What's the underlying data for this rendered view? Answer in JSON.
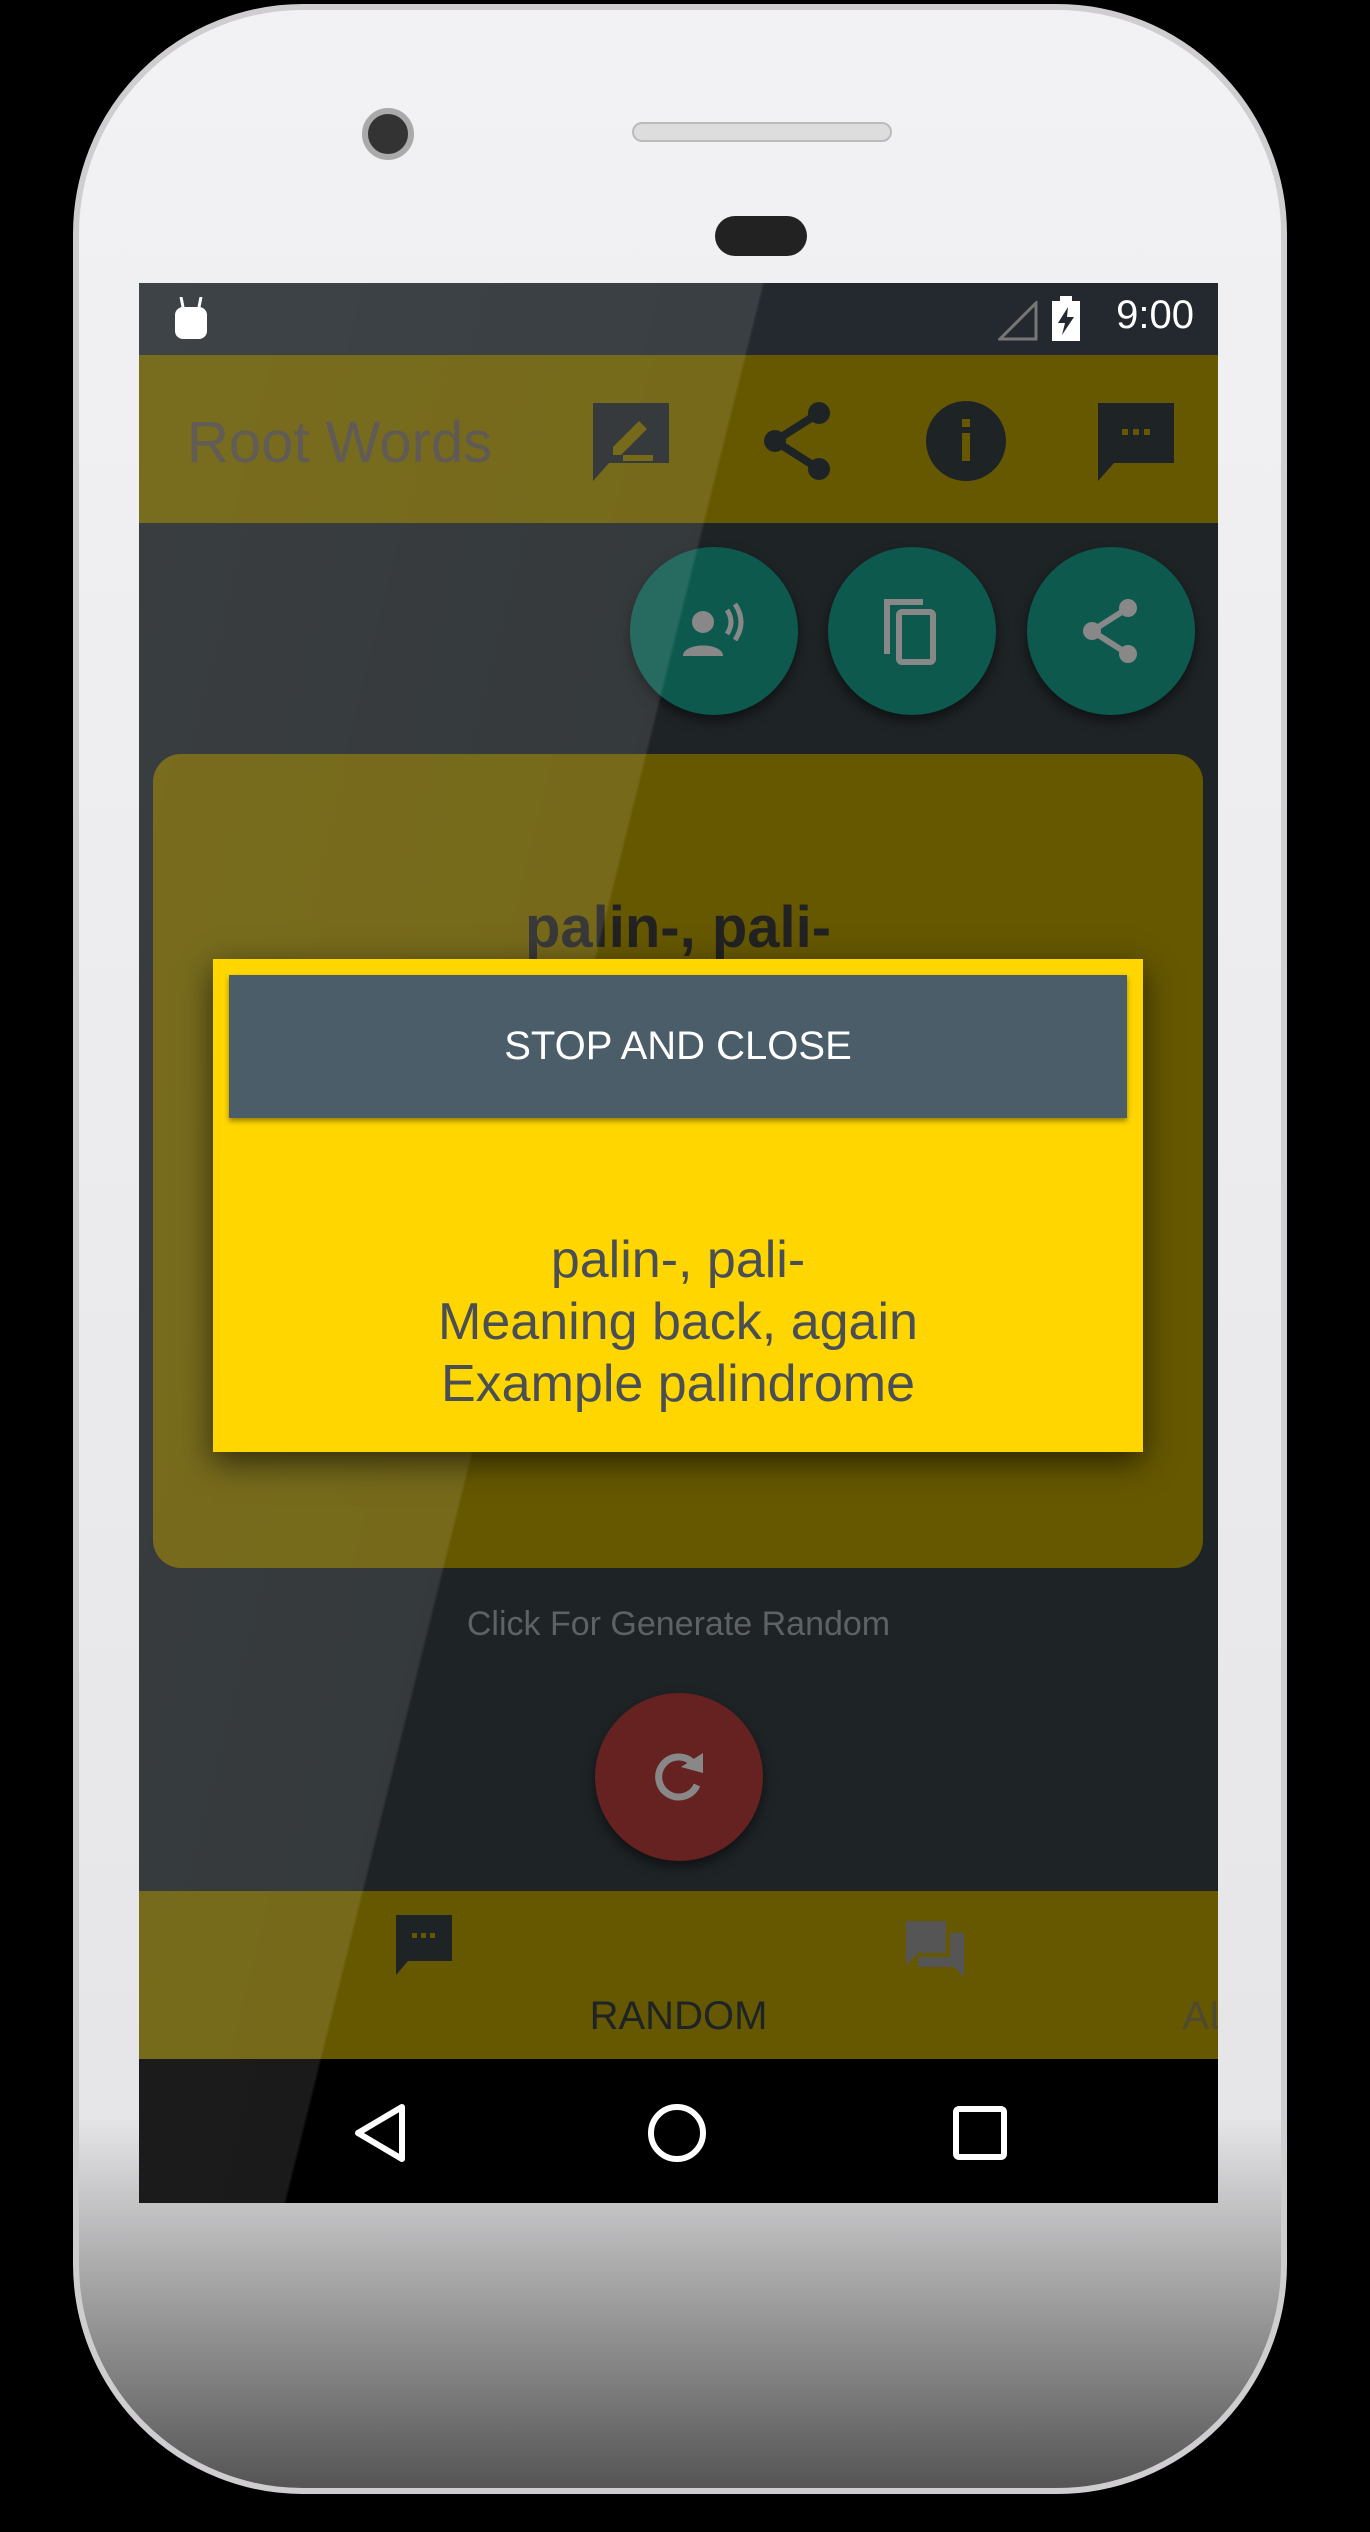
{
  "status_bar": {
    "time": "9:00"
  },
  "toolbar": {
    "title": "Root Words",
    "icons": [
      "edit-note-icon",
      "share-icon",
      "info-icon",
      "chat-icon"
    ]
  },
  "actions": [
    "speak-icon",
    "copy-icon",
    "share-icon"
  ],
  "card": {
    "title": "palin-, pali-"
  },
  "hint": "Click For Generate Random",
  "bottom_nav": {
    "items": [
      {
        "label": "RANDOM",
        "active": true
      },
      {
        "label": "ALL",
        "active": false
      }
    ]
  },
  "dialog": {
    "button": "STOP AND CLOSE",
    "lines": [
      "palin-, pali-",
      "Meaning back, again",
      "Example palindrome"
    ]
  },
  "colors": {
    "toolbar": "#665800",
    "dialog": "#FFD600",
    "dialog_button": "#4A5D69",
    "fab": "#0D594E",
    "refresh": "#662220"
  }
}
